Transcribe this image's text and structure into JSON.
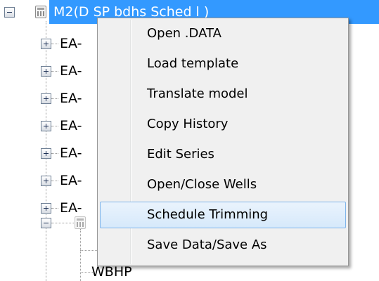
{
  "tree": {
    "root": {
      "label": "M2(D      SP bdhs  Sched  l )",
      "expander": "minus"
    },
    "children": [
      {
        "label": "EA-",
        "expander": "plus"
      },
      {
        "label": "EA-",
        "expander": "plus"
      },
      {
        "label": "EA-",
        "expander": "plus"
      },
      {
        "label": "EA-",
        "expander": "plus"
      },
      {
        "label": "EA-",
        "expander": "plus"
      },
      {
        "label": "EA-",
        "expander": "plus"
      },
      {
        "label": "EA-",
        "expander": "plus"
      },
      {
        "label": "",
        "expander": "minus"
      }
    ],
    "leaf_label": "WBHP"
  },
  "context_menu": {
    "items": [
      {
        "label": "Open .DATA"
      },
      {
        "label": "Load template"
      },
      {
        "label": "Translate model"
      },
      {
        "label": "Copy History"
      },
      {
        "label": "Edit Series"
      },
      {
        "label": "Open/Close Wells"
      },
      {
        "label": "Schedule Trimming",
        "hovered": true
      },
      {
        "label": "Save Data/Save As"
      }
    ]
  },
  "colors": {
    "selection": "#3399ff",
    "menu_background": "#f0f0f0",
    "menu_hover_border": "#7eb4ea"
  }
}
